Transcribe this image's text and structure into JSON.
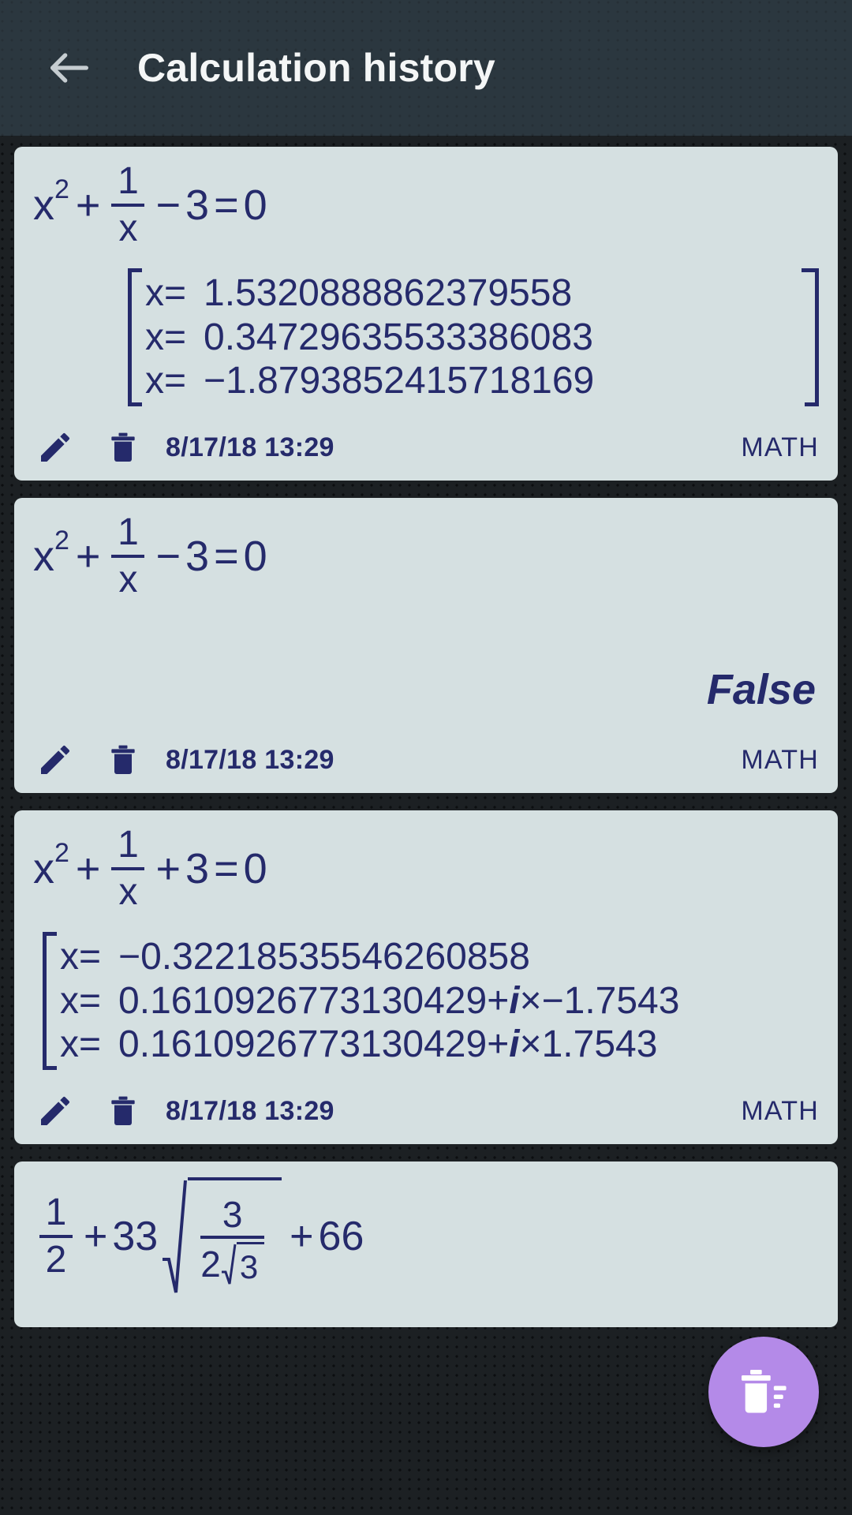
{
  "header": {
    "back_icon": "back-arrow-icon",
    "title": "Calculation history"
  },
  "colors": {
    "appbar_bg": "#2b373f",
    "page_bg": "#1c2023",
    "card_bg": "#d5e0e1",
    "text": "#252a6b",
    "fab_bg": "#b48ae8",
    "title_text": "#f4f6f6"
  },
  "fab": {
    "icon": "clear-all-trash-icon",
    "label": "Clear history"
  },
  "entries": [
    {
      "expression": {
        "base": "x",
        "exponent": "2",
        "op1": "+",
        "fraction_num": "1",
        "fraction_den": "x",
        "op2": "−",
        "term": "3",
        "equals": "=",
        "rhs": "0",
        "plain": "x^2 + 1/x − 3 = 0"
      },
      "result_type": "bracket-list",
      "results": [
        {
          "label": "x=",
          "value": "1.5320888862379558"
        },
        {
          "label": "x=",
          "value": "0.34729635533386083"
        },
        {
          "label": "x=",
          "value": "−1.8793852415718169"
        }
      ],
      "timestamp": "8/17/18 13:29",
      "mode_tag": "MATH",
      "edit_icon": "pencil-icon",
      "delete_icon": "trash-icon"
    },
    {
      "expression": {
        "base": "x",
        "exponent": "2",
        "op1": "+",
        "fraction_num": "1",
        "fraction_den": "x",
        "op2": "−",
        "term": "3",
        "equals": "=",
        "rhs": "0",
        "plain": "x^2 + 1/x − 3 = 0"
      },
      "result_type": "single",
      "single_result": "False",
      "timestamp": "8/17/18 13:29",
      "mode_tag": "MATH",
      "edit_icon": "pencil-icon",
      "delete_icon": "trash-icon"
    },
    {
      "expression": {
        "base": "x",
        "exponent": "2",
        "op1": "+",
        "fraction_num": "1",
        "fraction_den": "x",
        "op2": "+",
        "term": "3",
        "equals": "=",
        "rhs": "0",
        "plain": "x^2 + 1/x + 3 = 0"
      },
      "result_type": "bracket-list",
      "results": [
        {
          "label": "x=",
          "value": "−0.32218535546260858"
        },
        {
          "label": "x=",
          "real": "0.16109267731304 29",
          "value": "0.1610926773130429",
          "op": "+",
          "imag_unit": "i",
          "times": "×",
          "imag": "−1.7543"
        },
        {
          "label": "x=",
          "value": "0.1610926773130429",
          "op": "+",
          "imag_unit": "i",
          "times": "×",
          "imag": "1.7543"
        }
      ],
      "timestamp": "8/17/18 13:29",
      "mode_tag": "MATH",
      "edit_icon": "pencil-icon",
      "delete_icon": "trash-icon"
    },
    {
      "expression": {
        "frac_num": "1",
        "frac_den": "2",
        "op1": "+",
        "coeff": "33",
        "radicand_num": "3",
        "radicand_den_coeff": "2",
        "radicand_den_root": "3",
        "op2": "+",
        "tail": "66",
        "plain": "1/2 + 33√(3/(2√3)) + 66"
      },
      "result_type": "none"
    }
  ]
}
